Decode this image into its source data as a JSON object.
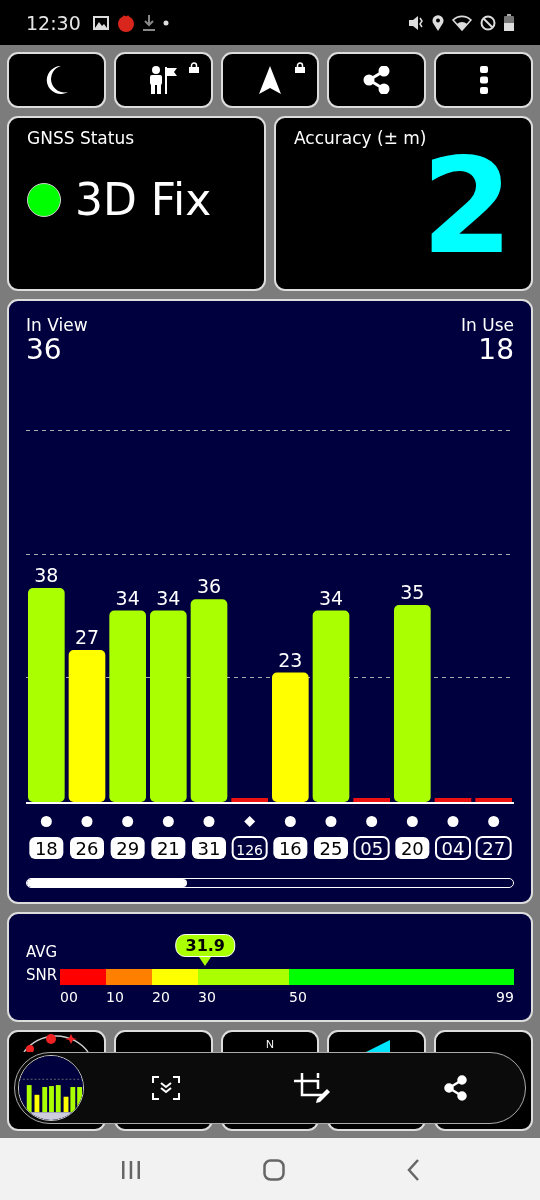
{
  "status_bar": {
    "time": "12:30"
  },
  "toolbar": [
    {
      "kind": "moon",
      "locked": false
    },
    {
      "kind": "person_flag",
      "locked": true
    },
    {
      "kind": "arrow",
      "locked": true
    },
    {
      "kind": "share",
      "locked": false
    },
    {
      "kind": "more",
      "locked": false
    }
  ],
  "gnss_status": {
    "title": "GNSS Status",
    "fix": "3D Fix",
    "color": "#00ff00"
  },
  "accuracy": {
    "title": "Accuracy (± m)",
    "value": "2"
  },
  "satellites_panel": {
    "in_view_label": "In View",
    "in_view": "36",
    "in_use_label": "In Use",
    "in_use": "18",
    "chart_data": {
      "type": "bar",
      "categories": [
        "18",
        "26",
        "29",
        "21",
        "31",
        "126",
        "16",
        "25",
        "05",
        "20",
        "04",
        "27"
      ],
      "values": [
        38,
        27,
        34,
        34,
        36,
        0,
        23,
        34,
        0,
        35,
        0,
        0
      ],
      "value_labels": [
        "38",
        "27",
        "34",
        "34",
        "36",
        null,
        "23",
        "34",
        null,
        "35",
        null,
        null
      ]
    },
    "satellites": [
      {
        "in_use": true,
        "kind": "dot"
      },
      {
        "in_use": true,
        "kind": "dot"
      },
      {
        "in_use": true,
        "kind": "dot"
      },
      {
        "in_use": true,
        "kind": "dot"
      },
      {
        "in_use": true,
        "kind": "dot"
      },
      {
        "in_use": false,
        "kind": "diamond"
      },
      {
        "in_use": true,
        "kind": "dot"
      },
      {
        "in_use": true,
        "kind": "dot"
      },
      {
        "in_use": false,
        "kind": "dot"
      },
      {
        "in_use": true,
        "kind": "dot"
      },
      {
        "in_use": false,
        "kind": "dot"
      },
      {
        "in_use": false,
        "kind": "dot"
      }
    ]
  },
  "snr": {
    "label_1": "AVG",
    "label_2": "SNR",
    "average": "31.9",
    "scale": [
      {
        "label": "00",
        "color": "#ff0000"
      },
      {
        "label": "10",
        "color": "#ff8000"
      },
      {
        "label": "20",
        "color": "#ffff00"
      },
      {
        "label": "30",
        "color": "#aaff00"
      },
      {
        "label": "50",
        "color": "#00ff00"
      },
      {
        "label": "99"
      }
    ]
  },
  "bottom_tiles": {
    "compass_label": "N"
  }
}
